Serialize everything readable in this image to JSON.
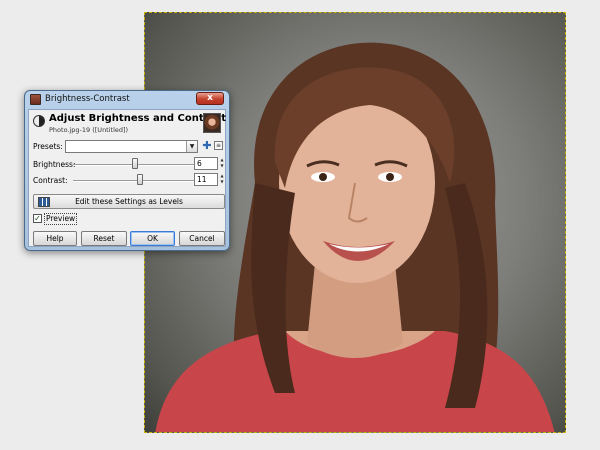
{
  "dialog": {
    "window_title": "Brightness-Contrast",
    "close_label": "x",
    "header_title": "Adjust Brightness and Contrast",
    "header_subtitle": "Photo.jpg-19 ([Untitled])",
    "presets_label": "Presets:",
    "presets_value": "",
    "brightness": {
      "label": "Brightness:",
      "value": "6"
    },
    "contrast": {
      "label": "Contrast:",
      "value": "11"
    },
    "levels_button_label": "Edit these Settings as Levels",
    "preview": {
      "label": "Preview",
      "checked": true
    },
    "buttons": {
      "help": "Help",
      "reset": "Reset",
      "ok": "OK",
      "cancel": "Cancel"
    }
  },
  "icons": {
    "app": "gimp-image-icon",
    "header": "brightness-contrast-icon",
    "add_preset": "plus-icon",
    "preset_menu": "menu-icon",
    "levels": "levels-icon",
    "combo": "chevron-down-icon"
  },
  "colors": {
    "titlebar": "#b9d1ea",
    "close_button": "#c4412d",
    "dialog_body": "#f0f0f0",
    "canvas_selection": "#c8b400"
  }
}
